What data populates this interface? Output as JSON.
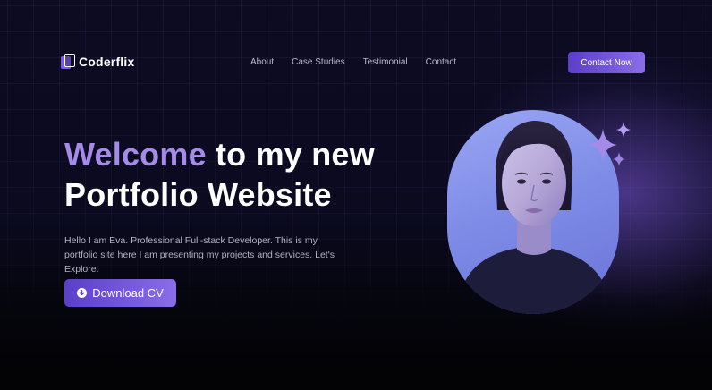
{
  "nav": {
    "logo_text": "Coderflix",
    "links": [
      {
        "label": "About"
      },
      {
        "label": "Case Studies"
      },
      {
        "label": "Testimonial"
      },
      {
        "label": "Contact"
      }
    ],
    "cta_label": "Contact Now"
  },
  "hero": {
    "headline_accent": "Welcome",
    "headline_rest_line1": " to my new",
    "headline_line2": "Portfolio Website",
    "intro": "Hello I am Eva. Professional Full-stack Developer. This is my portfolio site here I am presenting my projects and services. Let's Explore.",
    "download_label": "Download CV"
  },
  "icons": {
    "logo": "logo-icon",
    "download": "download-arrow-icon",
    "sparkles": "sparkles-icon"
  },
  "colors": {
    "accent": "#a58ae8",
    "button_start": "#5a3fc8",
    "button_end": "#8b6de8",
    "background": "#0b0a1f"
  }
}
